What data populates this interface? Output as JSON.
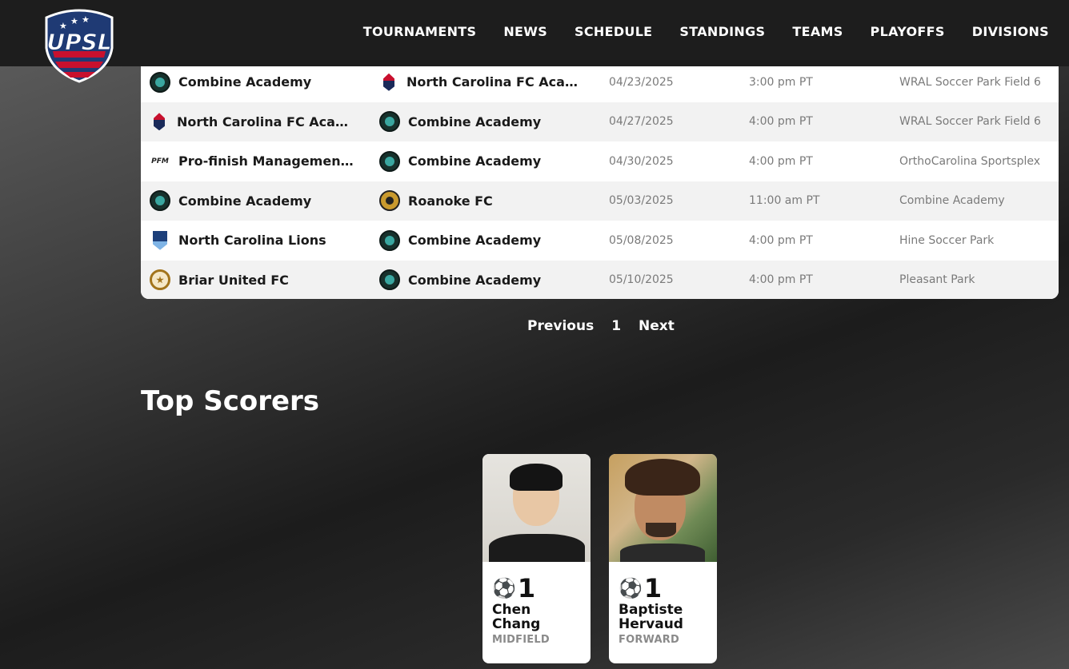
{
  "header": {
    "logo_text": "UPSL",
    "nav": [
      "TOURNAMENTS",
      "NEWS",
      "SCHEDULE",
      "STANDINGS",
      "TEAMS",
      "PLAYOFFS",
      "DIVISIONS"
    ]
  },
  "matches": [
    {
      "home": "Combine Academy",
      "home_badge": "combine-badge-icon",
      "away": "North Carolina FC Academy",
      "away_badge": "ncfc-badge-icon",
      "date": "04/23/2025",
      "time": "3:00 pm PT",
      "venue": "WRAL Soccer Park Field 6"
    },
    {
      "home": "North Carolina FC Academy",
      "home_badge": "ncfc-badge-icon",
      "away": "Combine Academy",
      "away_badge": "combine-badge-icon",
      "date": "04/27/2025",
      "time": "4:00 pm PT",
      "venue": "WRAL Soccer Park Field 6"
    },
    {
      "home": "Pro-finish Management FC",
      "home_badge": "pfm-badge-icon",
      "away": "Combine Academy",
      "away_badge": "combine-badge-icon",
      "date": "04/30/2025",
      "time": "4:00 pm PT",
      "venue": "OrthoCarolina Sportsplex"
    },
    {
      "home": "Combine Academy",
      "home_badge": "combine-badge-icon",
      "away": "Roanoke FC",
      "away_badge": "roanoke-badge-icon",
      "date": "05/03/2025",
      "time": "11:00 am PT",
      "venue": "Combine Academy"
    },
    {
      "home": "North Carolina Lions",
      "home_badge": "lions-badge-icon",
      "away": "Combine Academy",
      "away_badge": "combine-badge-icon",
      "date": "05/08/2025",
      "time": "4:00 pm PT",
      "venue": "Hine Soccer Park"
    },
    {
      "home": "Briar United FC",
      "home_badge": "briar-badge-icon",
      "away": "Combine Academy",
      "away_badge": "combine-badge-icon",
      "date": "05/10/2025",
      "time": "4:00 pm PT",
      "venue": "Pleasant Park"
    }
  ],
  "pagination": {
    "previous": "Previous",
    "page": "1",
    "next": "Next"
  },
  "top_scorers": {
    "title": "Top Scorers",
    "players": [
      {
        "goals": "1",
        "first": "Chen",
        "last": "Chang",
        "position": "MIDFIELD"
      },
      {
        "goals": "1",
        "first": "Baptiste",
        "last": "Hervaud",
        "position": "FORWARD"
      }
    ]
  }
}
